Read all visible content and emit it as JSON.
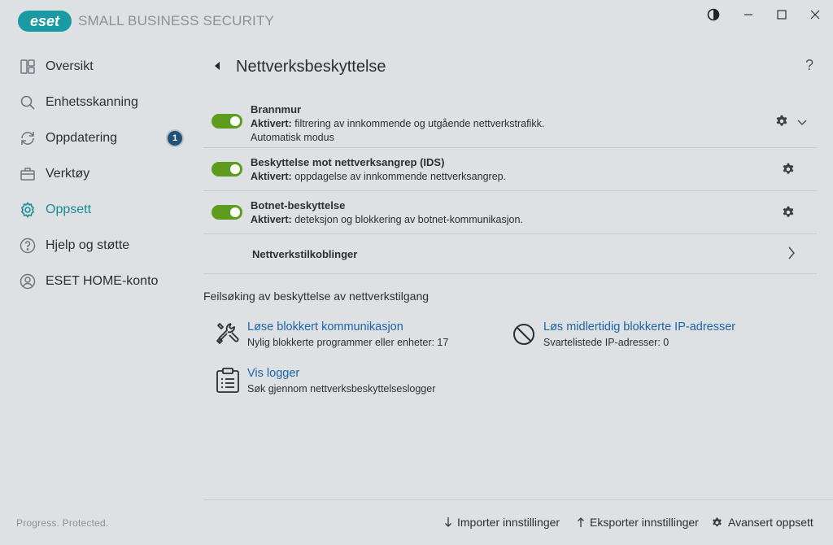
{
  "app": {
    "logo_text": "eset",
    "product_name": "SMALL BUSINESS SECURITY",
    "brand_color": "#1a8a93",
    "window_controls": [
      "contrast-icon",
      "minimize-icon",
      "maximize-icon",
      "close-icon"
    ]
  },
  "sidebar": {
    "items": [
      {
        "label": "Oversikt",
        "icon": "dashboard-icon"
      },
      {
        "label": "Enhetsskanning",
        "icon": "search-icon"
      },
      {
        "label": "Oppdatering",
        "icon": "refresh-icon",
        "badge": "1"
      },
      {
        "label": "Verktøy",
        "icon": "briefcase-icon"
      },
      {
        "label": "Oppsett",
        "icon": "gear-icon",
        "active": true
      },
      {
        "label": "Hjelp og støtte",
        "icon": "help-icon"
      },
      {
        "label": "ESET HOME-konto",
        "icon": "account-icon"
      }
    ],
    "footer": "Progress. Protected."
  },
  "main": {
    "title": "Nettverksbeskyttelse",
    "help": "?",
    "rows": [
      {
        "title": "Brannmur",
        "status": "Aktivert:",
        "desc": " filtrering av innkommende og utgående nettverkstrafikk.",
        "sub": "Automatisk modus",
        "enabled": true
      },
      {
        "title": "Beskyttelse mot nettverksangrep (IDS)",
        "status": "Aktivert:",
        "desc": " oppdagelse av innkommende nettverksangrep.",
        "enabled": true
      },
      {
        "title": "Botnet-beskyttelse",
        "status": "Aktivert:",
        "desc": " deteksjon og blokkering av botnet-kommunikasjon.",
        "enabled": true
      }
    ],
    "link_row": "Nettverkstilkoblinger",
    "section_title": "Feilsøking av beskyttelse av nettverkstilgang",
    "tools": [
      {
        "link": "Løse blokkert kommunikasjon",
        "desc": "Nylig blokkerte programmer eller enheter: 17",
        "icon": "tools-icon"
      },
      {
        "link": "Løs midlertidig blokkerte IP-adresser",
        "desc": "Svartelistede IP-adresser: 0",
        "icon": "blocked-icon"
      },
      {
        "link": "Vis logger",
        "desc": "Søk gjennom nettverksbeskyttelseslogger",
        "icon": "clipboard-icon"
      }
    ]
  },
  "bottom": {
    "import": "Importer innstillinger",
    "export": "Eksporter innstillinger",
    "advanced": "Avansert oppsett"
  }
}
